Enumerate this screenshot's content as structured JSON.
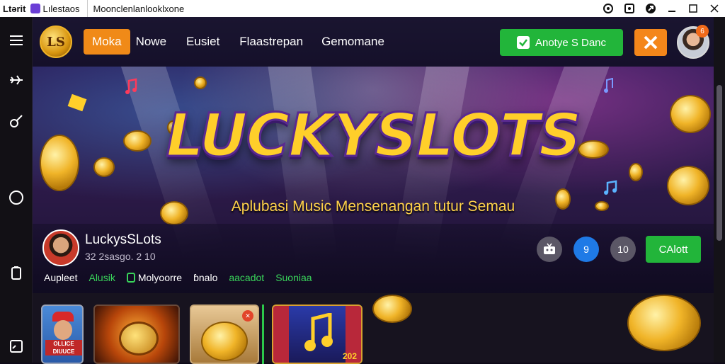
{
  "titlebar": {
    "app_short": "Ltərit",
    "app_name": "Lılestaos",
    "window_title": "Moonclenlanlooklxone",
    "icons": [
      "help-icon",
      "screen-icon",
      "settings-icon",
      "minimize-icon",
      "maximize-icon",
      "close-icon"
    ]
  },
  "sidebar": {
    "icons": [
      "menu-icon",
      "plane-icon",
      "guitar-icon",
      "circle-icon",
      "clipboard-icon",
      "panel-icon"
    ]
  },
  "nav": {
    "logo_text": "LS",
    "tabs": [
      "Moka",
      "Nowe",
      "Eusiet",
      "Flaastrepan",
      "Gemomane"
    ],
    "active_tab": "Moka",
    "green_button": "Anotye S Danc",
    "avatar_badge": "6"
  },
  "banner": {
    "title": "LUCKYSLOTS",
    "subtitle": "Aplubasi Music Mensenangan tutur Semau"
  },
  "channel": {
    "name": "LuckysSLots",
    "stats": "32 2sasɡo. 2 10",
    "tabs": [
      {
        "label": "Aupleet",
        "color": "white"
      },
      {
        "label": "Alusik",
        "color": "green"
      },
      {
        "label": "Molyoorre",
        "color": "white"
      },
      {
        "label": "ɓnalo",
        "color": "white"
      },
      {
        "label": "aacadot",
        "color": "green"
      },
      {
        "label": "Suoniaa",
        "color": "green"
      }
    ],
    "round_btn_2": "9",
    "round_btn_3": "10",
    "action_button": "CAlott"
  },
  "thumbnails": {
    "first_label": "OLLICE DIUUCE",
    "third_badge": "✕",
    "fourth_number": "202"
  },
  "colors": {
    "accent_orange": "#f08a18",
    "accent_green": "#22b53a",
    "title_gold": "#ffcf2a",
    "background": "#0e0a18"
  }
}
